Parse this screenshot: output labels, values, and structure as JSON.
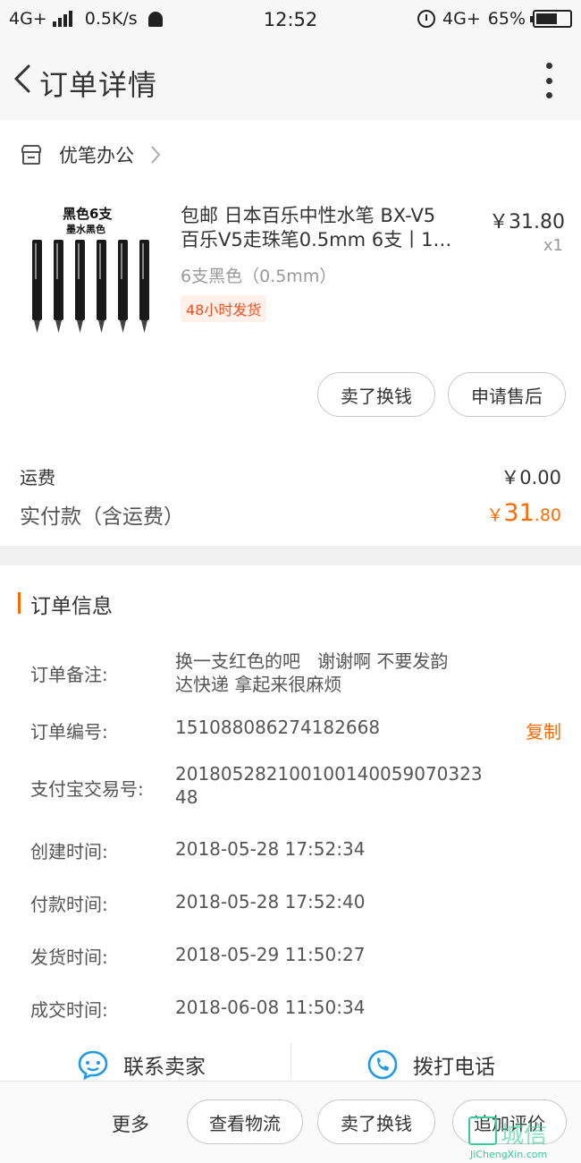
{
  "status_bar": {
    "network": "4G+",
    "speed": "0.5K/s",
    "time": "12:52",
    "network_right": "4G+",
    "battery": "65%"
  },
  "header": {
    "title": "订单详情"
  },
  "shop": {
    "name": "优笔办公"
  },
  "product": {
    "image_text_1": "黑色6支",
    "image_text_2": "墨水黑色",
    "title_line1": "包邮 日本百乐中性水笔 BX-V5",
    "title_line2": "百乐V5走珠笔0.5mm 6支丨1…",
    "price": "￥31.80",
    "quantity": "x1",
    "sku": "6支黑色（0.5mm）",
    "tag": "48小时发货",
    "btn_sell": "卖了换钱",
    "btn_after_sale": "申请售后"
  },
  "summary": {
    "shipping_label": "运费",
    "shipping_value": "￥0.00",
    "paid_label": "实付款（含运费）",
    "paid_currency": "￥",
    "paid_integer": "31",
    "paid_decimal": ".80"
  },
  "order_info": {
    "section_title": "订单信息",
    "note_label": "订单备注:",
    "note_value_line1": "换一支红色的吧   谢谢啊 不要发韵",
    "note_value_line2": "达快递 拿起来很麻烦",
    "order_no_label": "订单编号:",
    "order_no_value": "151088086274182668",
    "copy_label": "复制",
    "alipay_label": "支付宝交易号:",
    "alipay_value": "20180528210010014005907032348",
    "created_label": "创建时间:",
    "created_value": "2018-05-28 17:52:34",
    "paid_label": "付款时间:",
    "paid_value": "2018-05-28 17:52:40",
    "shipped_label": "发货时间:",
    "shipped_value": "2018-05-29 11:50:27",
    "closed_label": "成交时间:",
    "closed_value": "2018-06-08 11:50:34"
  },
  "contact": {
    "seller": "联系卖家",
    "call": "拨打电话"
  },
  "bottom_bar": {
    "more": "更多",
    "logistics": "查看物流",
    "sell": "卖了换钱",
    "review": "追加评价"
  },
  "watermark": {
    "text": "城信",
    "sub": "JiChengXin.com"
  },
  "colors": {
    "accent": "#ff6a00",
    "tag_text": "#f24e1e",
    "contact_blue": "#1e9ae6"
  }
}
